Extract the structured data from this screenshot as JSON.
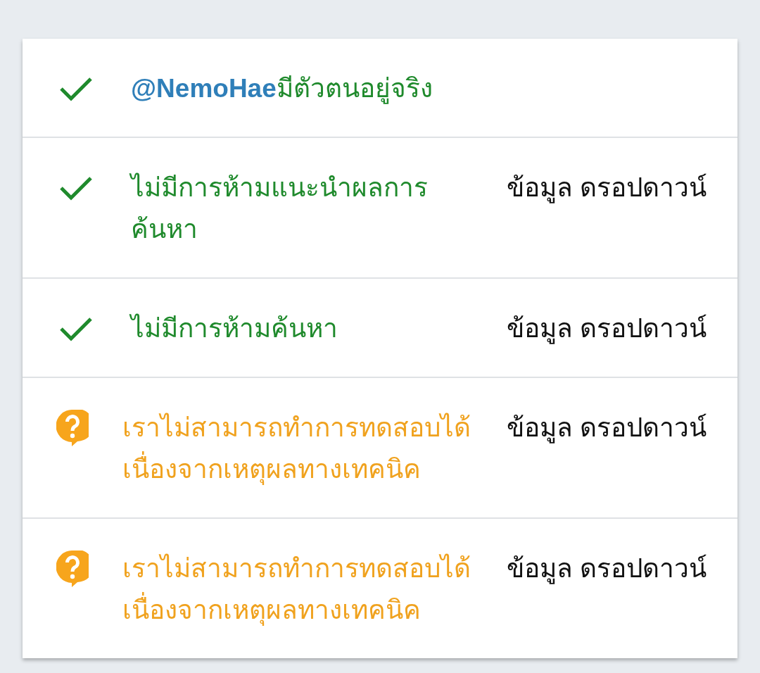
{
  "rows": [
    {
      "kind": "passed",
      "text": "**@NemoHae**มีตัวตนอยู่จริง"
    },
    {
      "kind": "passed",
      "text": "ไม่มีการห้ามแนะนำผลการค้นหา",
      "detail": "ข้อมูล ดรอปดาวน์"
    },
    {
      "kind": "passed",
      "text": "ไม่มีการห้ามค้นหา",
      "detail": "ข้อมูล ดรอปดาวน์"
    },
    {
      "kind": "untested",
      "text": "เราไม่สามารถทำการทดสอบได้เนื่องจากเหตุผลทางเทคนิค",
      "detail": "ข้อมูล ดรอปดาวน์"
    },
    {
      "kind": "untested",
      "text": "เราไม่สามารถทำการทดสอบได้เนื่องจากเหตุผลทางเทคนิค",
      "detail": "ข้อมูล ดรอปดาวน์"
    }
  ]
}
